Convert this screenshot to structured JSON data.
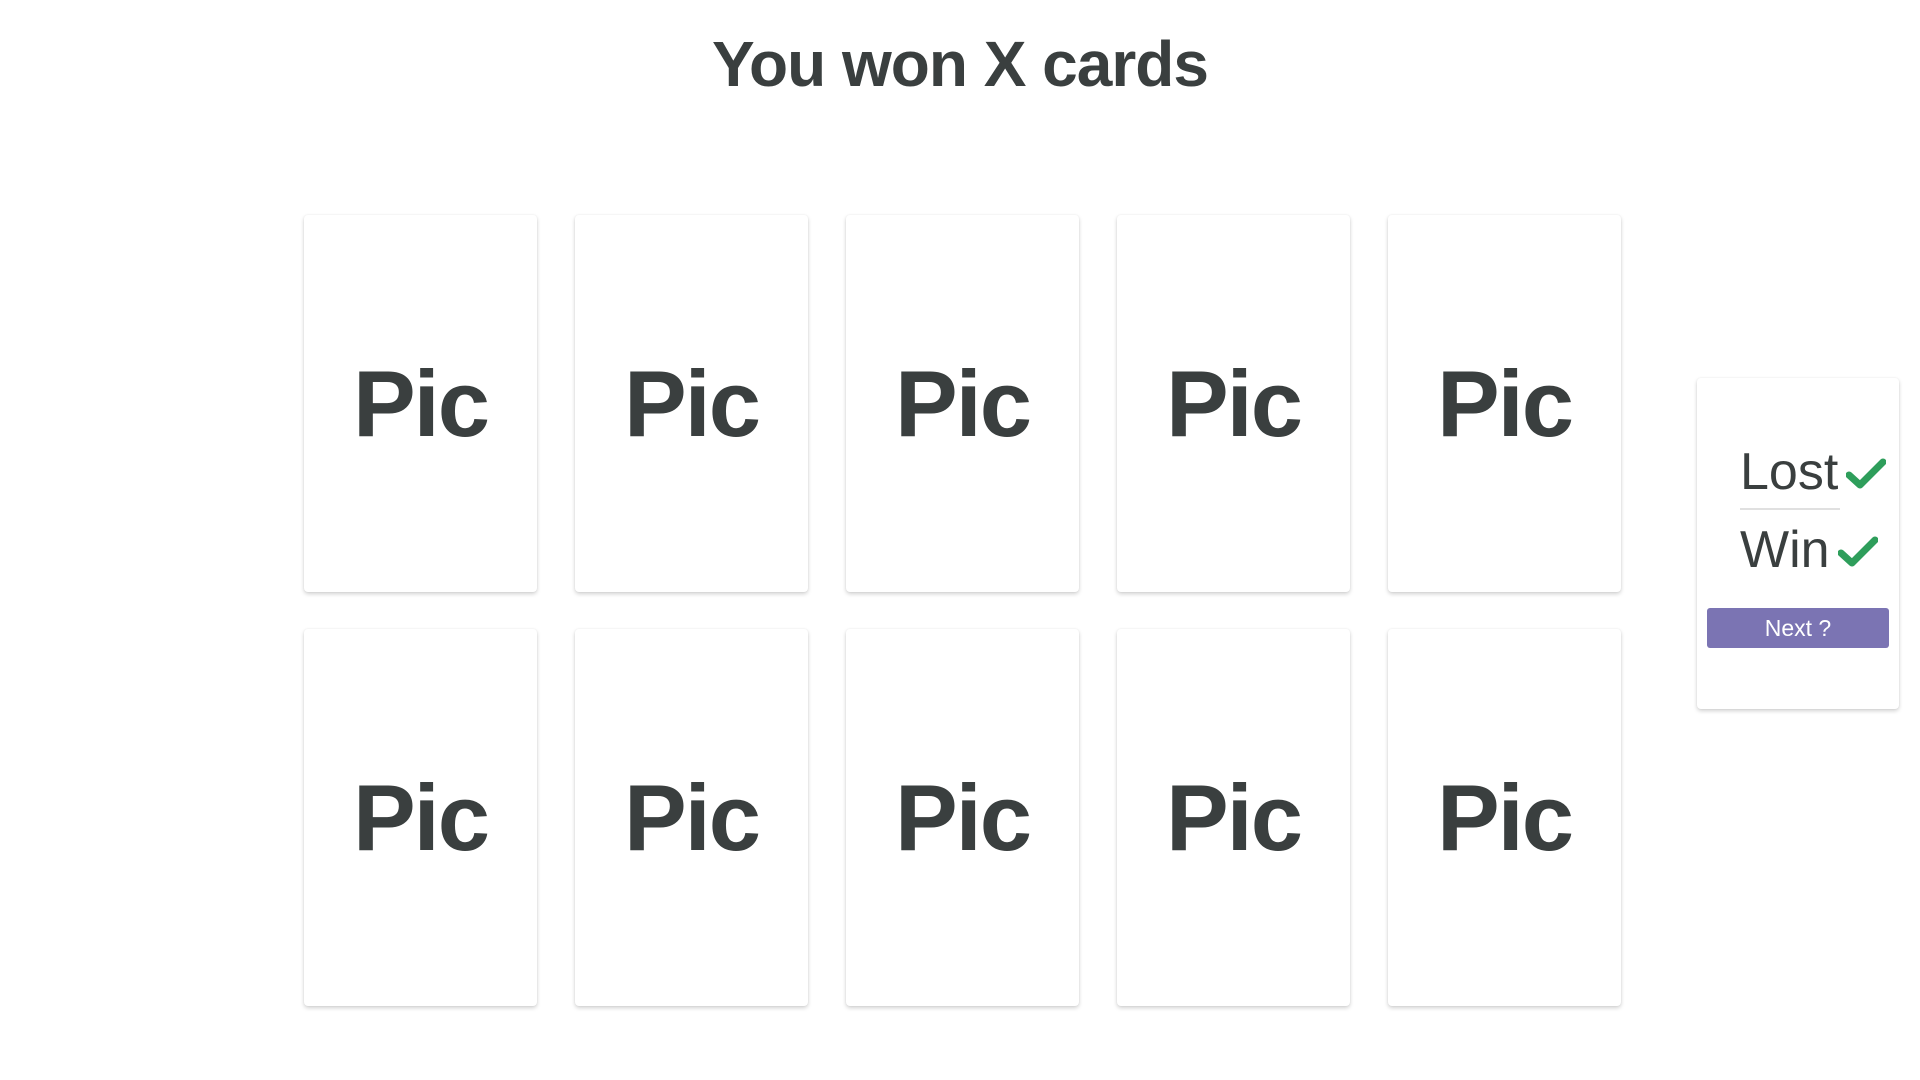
{
  "title": "You won X cards",
  "cards": [
    {
      "label": "Pic"
    },
    {
      "label": "Pic"
    },
    {
      "label": "Pic"
    },
    {
      "label": "Pic"
    },
    {
      "label": "Pic"
    },
    {
      "label": "Pic"
    },
    {
      "label": "Pic"
    },
    {
      "label": "Pic"
    },
    {
      "label": "Pic"
    },
    {
      "label": "Pic"
    }
  ],
  "panel": {
    "lost_label": "Lost",
    "win_label": "Win",
    "next_label": "Next ?",
    "check_icon": "check-icon",
    "check_color": "#2e9e5b",
    "button_color": "#7b74b3"
  }
}
